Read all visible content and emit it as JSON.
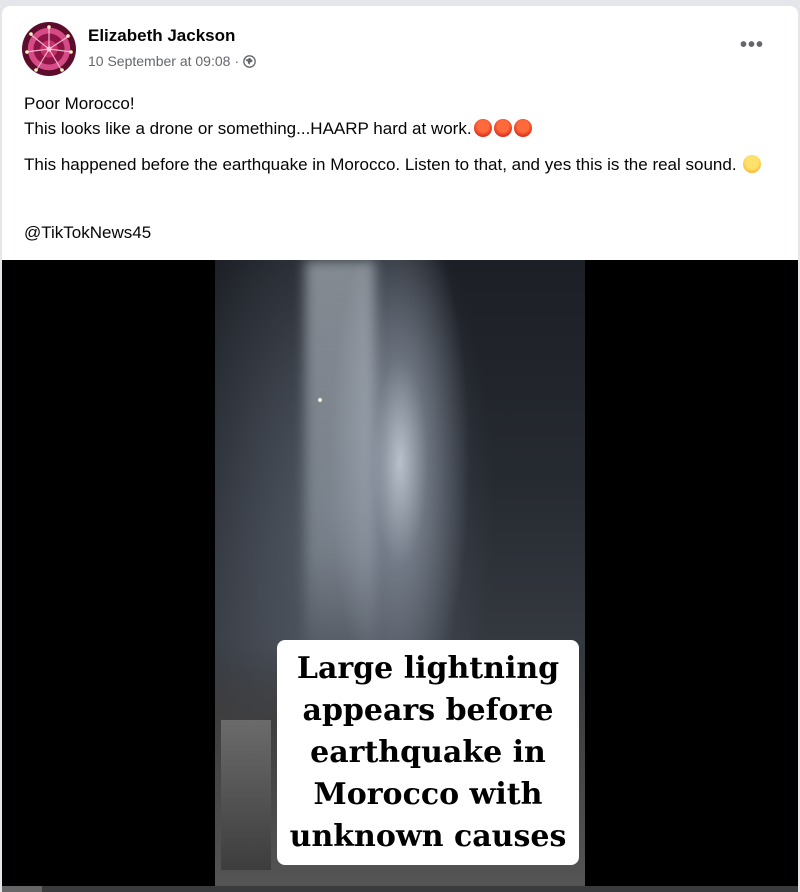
{
  "post": {
    "author": "Elizabeth Jackson",
    "timestamp": "10 September at 09:08",
    "separator": "·",
    "privacy_icon": "globe-icon",
    "more_label": "•••",
    "line1": "Poor Morocco!",
    "line2": "This looks like a drone or something...HAARP hard at work.",
    "line2_emojis": [
      "angry-face-emoji",
      "angry-face-emoji",
      "angry-face-emoji"
    ],
    "paragraph2": "This happened before the earthquake in Morocco. Listen to that, and yes this is the real sound.",
    "paragraph2_emoji": "thinking-face-emoji",
    "mention": "@TikTokNews45"
  },
  "video": {
    "caption": "Large lightning\nappears before\nearthquake in\nMorocco with\nunknown causes"
  },
  "colors": {
    "background": "#e4e6eb",
    "card": "#ffffff",
    "meta_text": "#65676b",
    "video_bg": "#000000"
  }
}
